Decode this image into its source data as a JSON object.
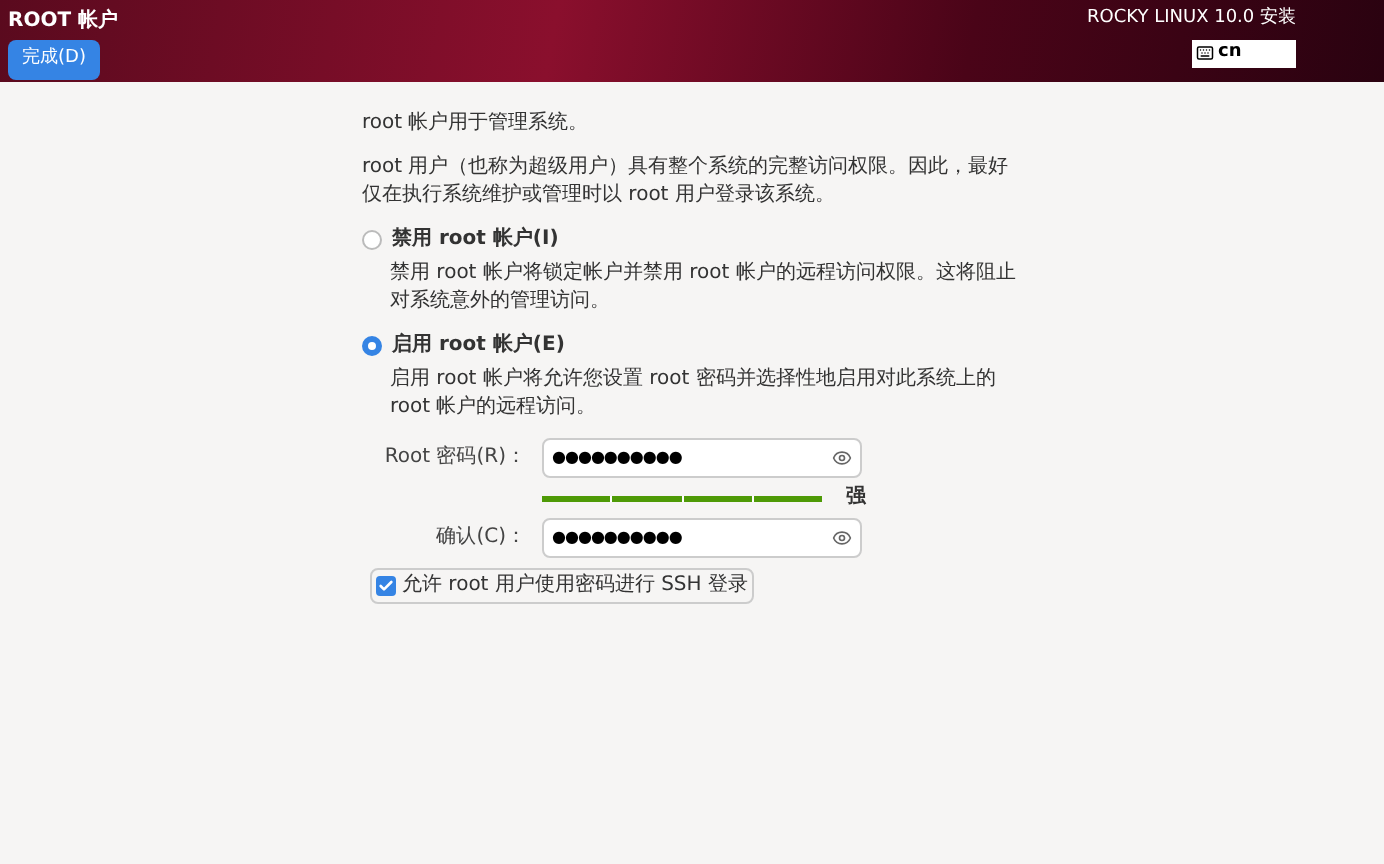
{
  "header": {
    "title": "ROOT 帐户",
    "done_button": "完成(D)",
    "product": "ROCKY LINUX 10.0 安装",
    "keyboard": "cn"
  },
  "intro": "root 帐户用于管理系统。",
  "description": "root 用户（也称为超级用户）具有整个系统的完整访问权限。因此，最好仅在执行系统维护或管理时以 root 用户登录该系统。",
  "options": [
    {
      "label": "禁用 root 帐户(I)",
      "description": "禁用 root 帐户将锁定帐户并禁用 root 帐户的远程访问权限。这将阻止对系统意外的管理访问。",
      "selected": false
    },
    {
      "label": "启用 root 帐户(E)",
      "description": "启用 root 帐户将允许您设置 root 密码并选择性地启用对此系统上的 root 帐户的远程访问。",
      "selected": true
    }
  ],
  "password": {
    "label": "Root 密码(R)：",
    "value": "●●●●●●●●●●",
    "level": 1,
    "strength": "强"
  },
  "confirm": {
    "label": "确认(C)：",
    "value": "●●●●●●●●●●"
  },
  "ssh": {
    "label": "允许 root 用户使用密码进行 SSH 登录",
    "checked": true
  }
}
